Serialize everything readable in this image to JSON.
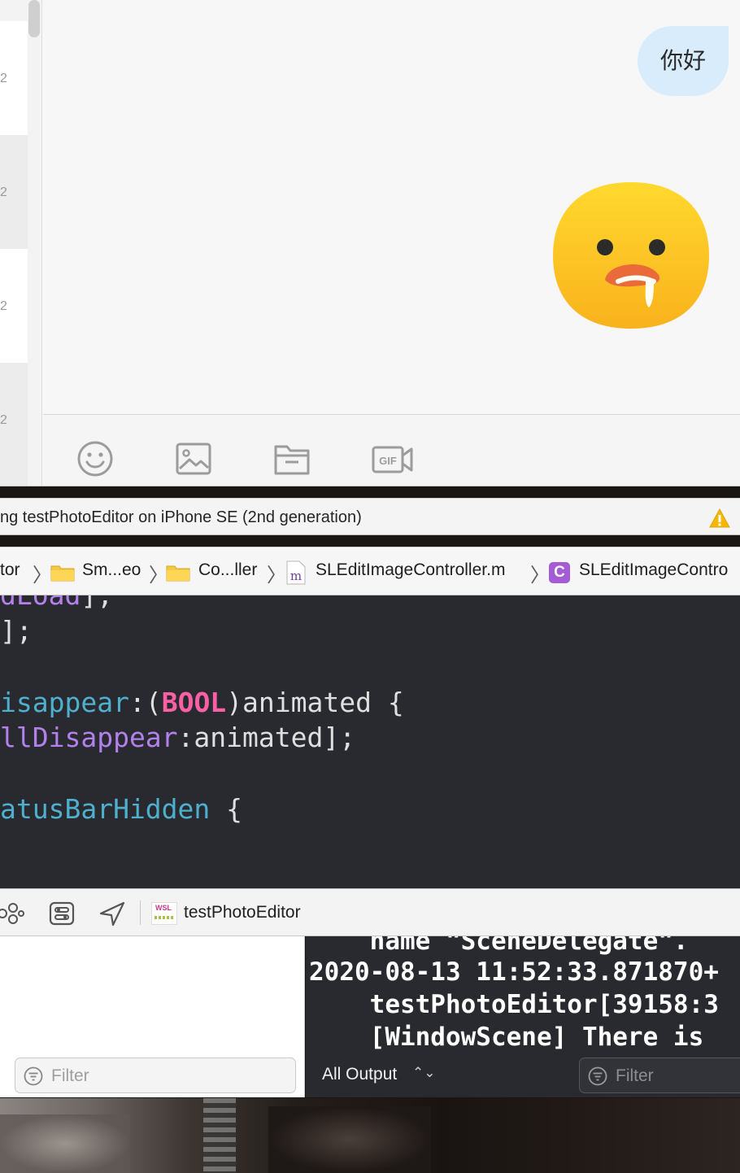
{
  "simulator": {
    "conversation_rows": [
      "2",
      "2",
      "2",
      "2"
    ],
    "message_bubble": "你好",
    "sticker": "drooling-face-sticker",
    "input_tools": [
      "emoji-icon",
      "image-icon",
      "folder-icon",
      "gif-video-icon"
    ]
  },
  "activity": {
    "status_text": "ng testPhotoEditor on iPhone SE (2nd generation)",
    "warning_icon": "warning-triangle-icon",
    "warning_color": "#f5b800"
  },
  "jumpbar": {
    "items": [
      "tor",
      "Sm...eo",
      "Co...ller",
      "SLEditImageController.m",
      "SLEditImageContro"
    ],
    "class_badge": "C"
  },
  "editor": {
    "lines": [
      {
        "parts": [
          {
            "t": "dLoad",
            "c": "pur"
          },
          {
            "t": "];",
            "c": "wht"
          }
        ]
      },
      {
        "parts": [
          {
            "t": "];",
            "c": "wht"
          }
        ]
      },
      {
        "parts": [
          {
            "t": "",
            "c": "wht"
          }
        ]
      },
      {
        "parts": [
          {
            "t": "isappear",
            "c": "tea"
          },
          {
            "t": ":(",
            "c": "wht"
          },
          {
            "t": "BOOL",
            "c": "pink"
          },
          {
            "t": ")animated {",
            "c": "wht"
          }
        ]
      },
      {
        "parts": [
          {
            "t": "llDisappear",
            "c": "pur"
          },
          {
            "t": ":animated];",
            "c": "wht"
          }
        ]
      },
      {
        "parts": [
          {
            "t": "",
            "c": "wht"
          }
        ]
      },
      {
        "parts": [
          {
            "t": "atusBarHidden",
            "c": "tea"
          },
          {
            "t": " {",
            "c": "wht"
          }
        ]
      }
    ]
  },
  "debugbar": {
    "app_icon_text": "WSL",
    "app_name": "testPhotoEditor"
  },
  "variables": {
    "filter_placeholder": "Filter"
  },
  "console": {
    "lines": [
      "    name \"SceneDelegate\".",
      "2020-08-13 11:52:33.871870+",
      "    testPhotoEditor[39158:3",
      "    [WindowScene] There is"
    ],
    "output_selector": "All Output",
    "output_selector_chevron": "⌃⌄",
    "filter_placeholder": "Filter"
  },
  "colors": {
    "editor_bg": "#292a30",
    "bubble_bg": "#d9ecfb",
    "keyword_pink": "#fc5fa3",
    "method_purple": "#b281eb",
    "method_teal": "#4eb0cc",
    "class_badge_purple": "#a55bd6"
  }
}
